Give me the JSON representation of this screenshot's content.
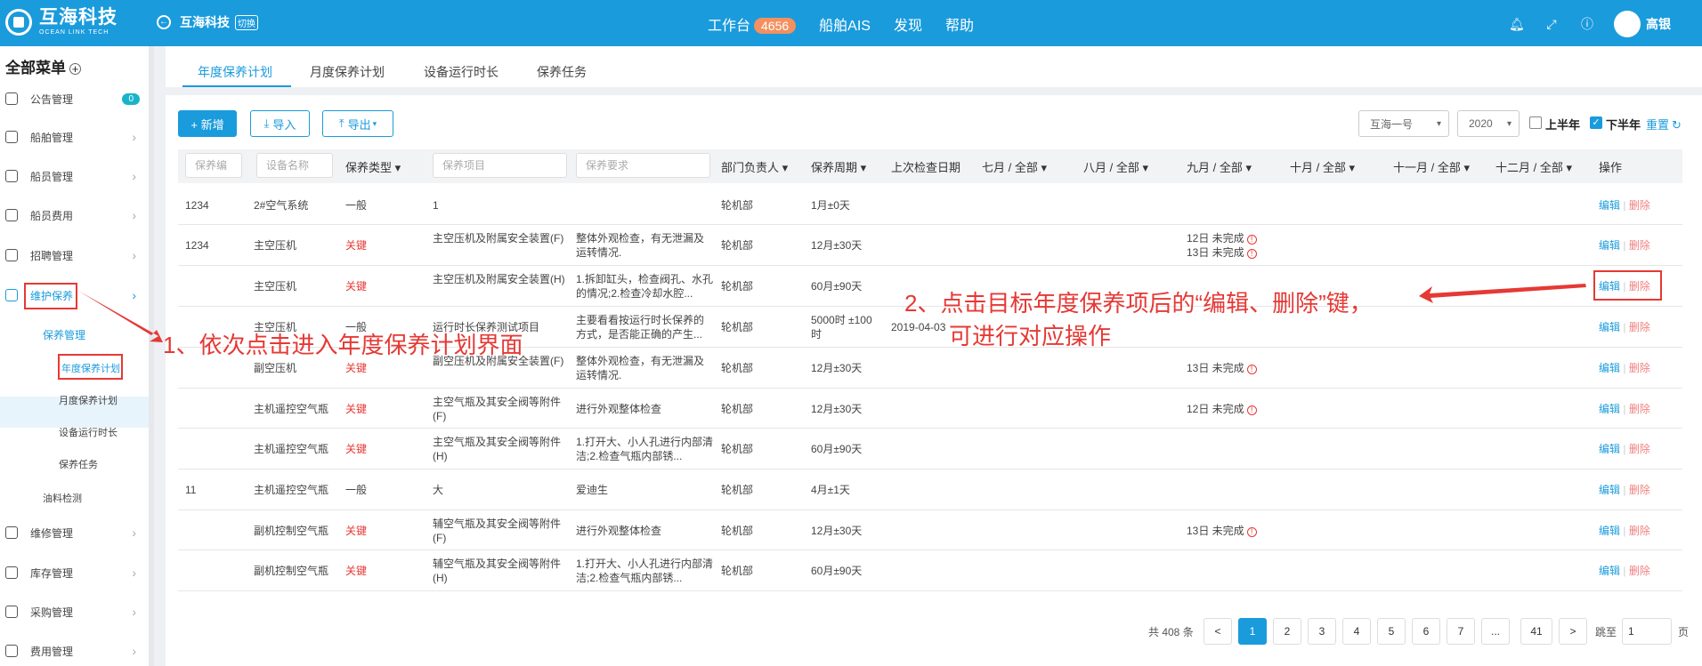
{
  "topbar": {
    "logo_cn": "互海科技",
    "logo_en": "OCEAN LINK TECH",
    "back_label": "互海科技",
    "switch_label": "切换",
    "nav": [
      {
        "label": "工作台",
        "badge": "4656"
      },
      {
        "label": "船舶AIS"
      },
      {
        "label": "发现"
      },
      {
        "label": "帮助"
      }
    ],
    "user": "高银"
  },
  "sidebar": {
    "title": "全部菜单",
    "items": [
      {
        "label": "公告管理",
        "badge": "0"
      },
      {
        "label": "船舶管理"
      },
      {
        "label": "船员管理"
      },
      {
        "label": "船员费用"
      },
      {
        "label": "招聘管理"
      },
      {
        "label": "维护保养"
      }
    ],
    "sub_title": "保养管理",
    "sub_items": [
      "年度保养计划",
      "月度保养计划",
      "设备运行时长",
      "保养任务"
    ],
    "oil": "油料检测",
    "items2": [
      "维修管理",
      "库存管理",
      "采购管理",
      "费用管理"
    ]
  },
  "tabs": [
    "年度保养计划",
    "月度保养计划",
    "设备运行时长",
    "保养任务"
  ],
  "toolbar": {
    "add": "+ 新增",
    "import": "导入",
    "export": "导出",
    "ship": "互海一号",
    "year": "2020",
    "first_half": "上半年",
    "second_half": "下半年",
    "reset": "重置"
  },
  "header": {
    "inputs": [
      "保养编",
      "设备名称",
      "保养项目",
      "保养要求"
    ],
    "cols": [
      "保养类型",
      "部门负责人",
      "保养周期",
      "上次检查日期",
      "七月 / 全部",
      "八月 / 全部",
      "九月 / 全部",
      "十月 / 全部",
      "十一月 / 全部",
      "十二月 / 全部",
      "操作"
    ]
  },
  "rows": [
    {
      "code": "1234",
      "device": "2#空气系统",
      "type": "一般",
      "item": "1",
      "req": "",
      "dept": "轮机部",
      "cycle": "1月±0天",
      "last": "",
      "sep": ""
    },
    {
      "code": "1234",
      "device": "主空压机",
      "type": "关键",
      "item": "主空压机及附属安全装置(F)",
      "req": "整体外观检查，有无泄漏及运转情况.",
      "dept": "轮机部",
      "cycle": "12月±30天",
      "last": "",
      "sep": "12日 未完成\n13日 未完成"
    },
    {
      "code": "",
      "device": "主空压机",
      "type": "关键",
      "item": "主空压机及附属安全装置(H)",
      "req": "1.拆卸缸头，检查阀孔、水孔的情况;2.检查冷却水腔...",
      "dept": "轮机部",
      "cycle": "60月±90天",
      "last": "",
      "sep": ""
    },
    {
      "code": "",
      "device": "主空压机",
      "type": "一般",
      "item": "运行时长保养测试项目",
      "req": "主要看看按运行时长保养的方式，是否能正确的产生...",
      "dept": "轮机部",
      "cycle": "5000时 ±100时",
      "last": "2019-04-03",
      "sep": ""
    },
    {
      "code": "",
      "device": "副空压机",
      "type": "关键",
      "item": "副空压机及附属安全装置(F)",
      "req": "整体外观检查，有无泄漏及运转情况.",
      "dept": "轮机部",
      "cycle": "12月±30天",
      "last": "",
      "sep": "13日 未完成"
    },
    {
      "code": "",
      "device": "主机遥控空气瓶",
      "type": "关键",
      "item": "主空气瓶及其安全阀等附件(F)",
      "req": "进行外观整体检查",
      "dept": "轮机部",
      "cycle": "12月±30天",
      "last": "",
      "sep": "12日 未完成"
    },
    {
      "code": "",
      "device": "主机遥控空气瓶",
      "type": "关键",
      "item": "主空气瓶及其安全阀等附件(H)",
      "req": "1.打开大、小人孔进行内部清洁;2.检查气瓶内部锈...",
      "dept": "轮机部",
      "cycle": "60月±90天",
      "last": "",
      "sep": ""
    },
    {
      "code": "11",
      "device": "主机遥控空气瓶",
      "type": "一般",
      "item": "大",
      "req": "爱迪生",
      "dept": "轮机部",
      "cycle": "4月±1天",
      "last": "",
      "sep": ""
    },
    {
      "code": "",
      "device": "副机控制空气瓶",
      "type": "关键",
      "item": "辅空气瓶及其安全阀等附件(F)",
      "req": "进行外观整体检查",
      "dept": "轮机部",
      "cycle": "12月±30天",
      "last": "",
      "sep": "13日 未完成"
    },
    {
      "code": "",
      "device": "副机控制空气瓶",
      "type": "关键",
      "item": "辅空气瓶及其安全阀等附件(H)",
      "req": "1.打开大、小人孔进行内部清洁;2.检查气瓶内部锈...",
      "dept": "轮机部",
      "cycle": "60月±90天",
      "last": "",
      "sep": ""
    }
  ],
  "actions": {
    "edit": "编辑",
    "delete": "删除"
  },
  "pagination": {
    "total": "共 408 条",
    "pages": [
      "1",
      "2",
      "3",
      "4",
      "5",
      "6",
      "7",
      "...",
      "41"
    ],
    "prev": "<",
    "next": ">",
    "jump": "跳至",
    "page_input": "1",
    "page_unit": "页"
  },
  "annotations": {
    "one": "1、依次点击进入年度保养计划界面",
    "two_a": "2、点击目标年度保养项后的“编辑、删除”键，",
    "two_b": "可进行对应操作"
  }
}
